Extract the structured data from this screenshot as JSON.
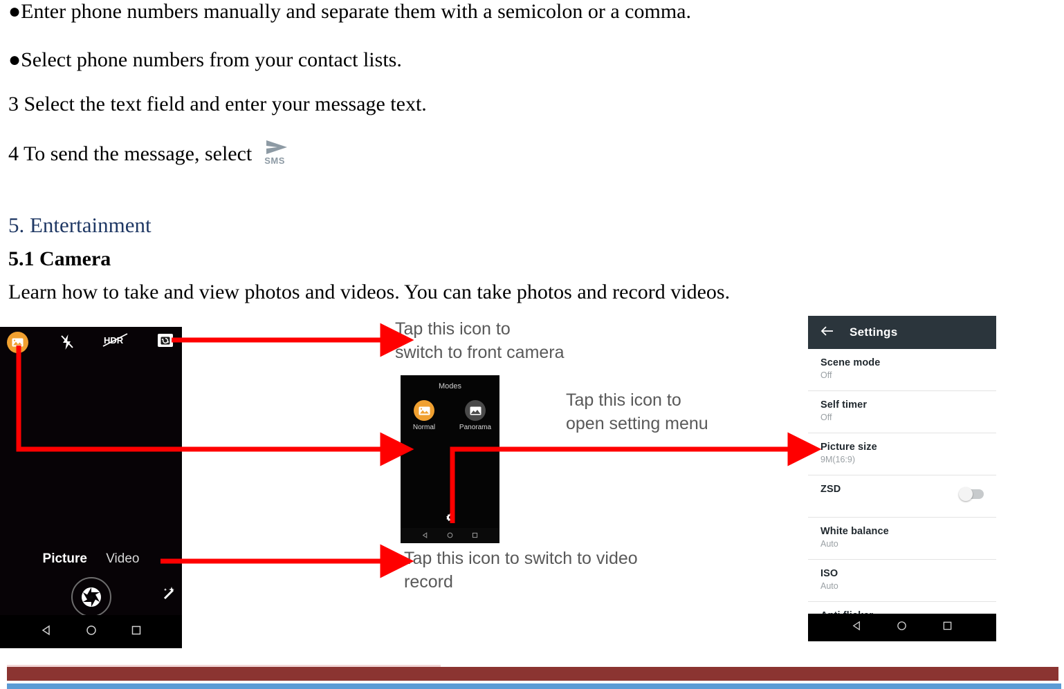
{
  "document": {
    "bullets": [
      "●Enter phone numbers manually and separate them with a semicolon or a comma.",
      "●Select phone numbers from your contact lists."
    ],
    "step3": "3 Select the text field and enter your message text.",
    "step4": "4 To send the message, select",
    "sms_icon_label": "SMS",
    "section_heading": "5. Entertainment",
    "sub_heading": "5.1 Camera",
    "intro": "Learn how to take and view photos and videos. You can take photos and record videos."
  },
  "camera_screen": {
    "icons": {
      "gallery": "gallery-icon",
      "flash_off": "flash-off-icon",
      "hdr_off": "HDR",
      "switch_camera": "switch-camera-icon",
      "shutter": "shutter-icon",
      "effects": "magic-wand-icon"
    },
    "modes": {
      "picture": "Picture",
      "video": "Video"
    },
    "nav": {
      "back": "back-icon",
      "home": "home-icon",
      "recents": "recents-icon"
    }
  },
  "modes_screen": {
    "title": "Modes",
    "items": [
      {
        "label": "Normal",
        "icon": "normal-mode-icon"
      },
      {
        "label": "Panorama",
        "icon": "panorama-mode-icon"
      }
    ],
    "gear": "settings-gear-icon"
  },
  "settings_screen": {
    "back": "back-arrow-icon",
    "title": "Settings",
    "rows": [
      {
        "label": "Scene mode",
        "value": "Off",
        "toggle": false
      },
      {
        "label": "Self timer",
        "value": "Off",
        "toggle": false
      },
      {
        "label": "Picture size",
        "value": "9M(16:9)",
        "toggle": false
      },
      {
        "label": "ZSD",
        "value": "",
        "toggle": true
      },
      {
        "label": "White balance",
        "value": "Auto",
        "toggle": false
      },
      {
        "label": "ISO",
        "value": "Auto",
        "toggle": false
      },
      {
        "label": "Anti flicker",
        "value": "",
        "toggle": false
      }
    ]
  },
  "callouts": {
    "front_camera": "Tap this icon to\nswitch to front camera",
    "setting_menu": "Tap this icon to\nopen setting menu",
    "video_record": "Tap this icon to switch to video\nrecord"
  },
  "colors": {
    "arrow_red": "#ff0000",
    "accent_orange": "#f0a030",
    "heading_blue": "#1f3864",
    "footer_maroon": "#8b3431",
    "footer_blue": "#5b9bd5",
    "callout_gray": "#595959",
    "settings_header": "#2b353c"
  }
}
